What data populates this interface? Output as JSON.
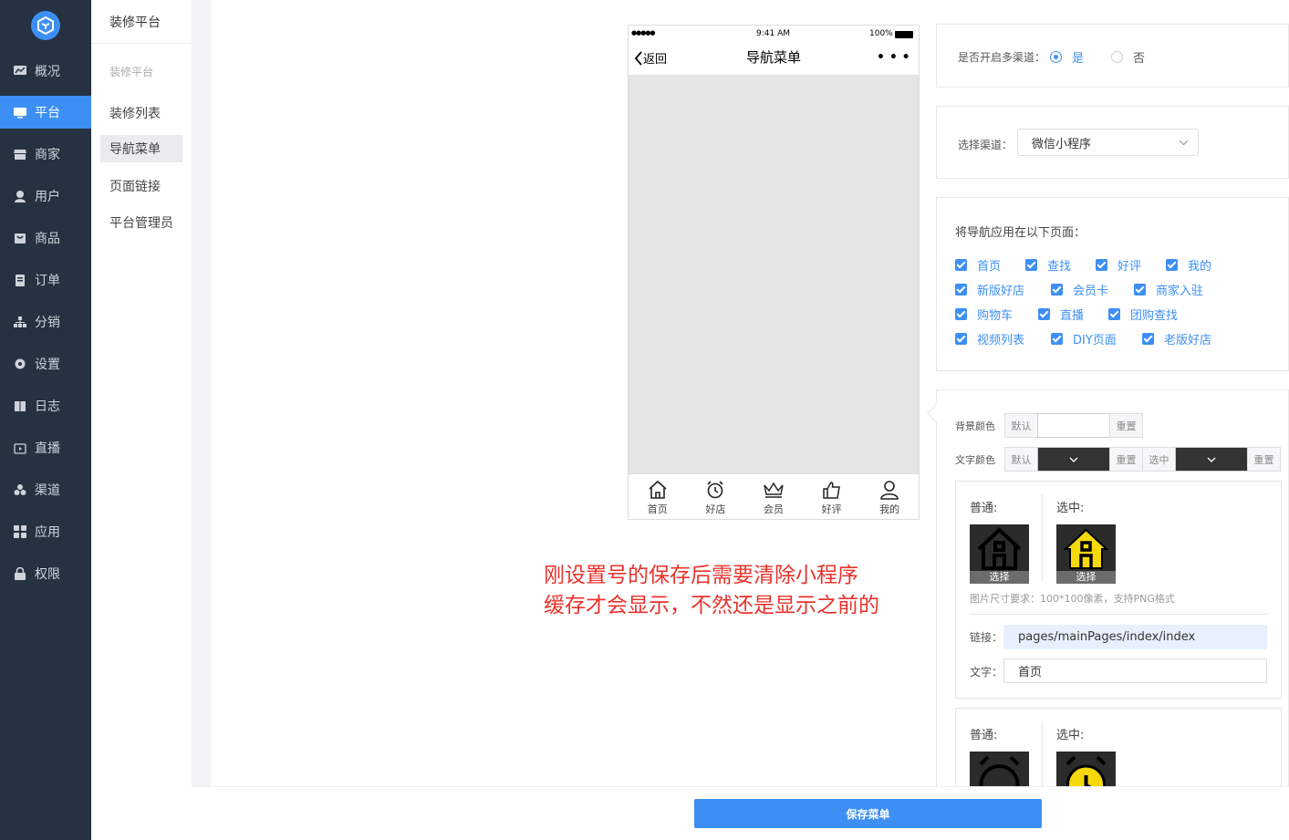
{
  "sidebar": {
    "items": [
      {
        "label": "概况",
        "icon": "chart-icon"
      },
      {
        "label": "平台",
        "icon": "monitor-icon"
      },
      {
        "label": "商家",
        "icon": "store-icon"
      },
      {
        "label": "用户",
        "icon": "user-icon"
      },
      {
        "label": "商品",
        "icon": "bag-icon"
      },
      {
        "label": "订单",
        "icon": "order-icon"
      },
      {
        "label": "分销",
        "icon": "tree-icon"
      },
      {
        "label": "设置",
        "icon": "gear-icon"
      },
      {
        "label": "日志",
        "icon": "book-icon"
      },
      {
        "label": "直播",
        "icon": "live-icon"
      },
      {
        "label": "渠道",
        "icon": "channel-icon"
      },
      {
        "label": "应用",
        "icon": "grid-icon"
      },
      {
        "label": "权限",
        "icon": "lock-icon"
      }
    ],
    "active": "平台"
  },
  "subnav": {
    "title": "装修平台",
    "group": "装修平台",
    "items": [
      "装修列表",
      "导航菜单",
      "页面链接",
      "平台管理员"
    ],
    "active": "导航菜单"
  },
  "phone": {
    "signal": "●●●●●",
    "time": "9:41 AM",
    "battery": "100%",
    "back_label": "返回",
    "title": "导航菜单",
    "more": "• • •",
    "tabs": [
      "首页",
      "好店",
      "会员",
      "好评",
      "我的"
    ]
  },
  "note": {
    "line1": "刚设置号的保存后需要清除小程序",
    "line2": "缓存才会显示，不然还是显示之前的"
  },
  "multi_channel": {
    "label": "是否开启多渠道：",
    "yes": "是",
    "no": "否",
    "selected": "是"
  },
  "channel_select": {
    "label": "选择渠道：",
    "value": "微信小程序"
  },
  "pages": {
    "title": "将导航应用在以下页面：",
    "options": [
      "首页",
      "查找",
      "好评",
      "我的",
      "新版好店",
      "会员卡",
      "商家入驻",
      "购物车",
      "直播",
      "团购查找",
      "视频列表",
      "DIY页面",
      "老版好店"
    ]
  },
  "style": {
    "bg_label": "背景颜色",
    "text_label": "文字颜色",
    "default": "默认",
    "reset": "重置",
    "selected": "选中",
    "bg_color": "#ffffff",
    "text_color": "#333333",
    "text_selected_color": "#333333"
  },
  "nav_items": [
    {
      "normal_label": "普通:",
      "selected_label": "选中:",
      "choose": "选择",
      "hint": "图片尺寸要求：100*100像素，支持PNG格式",
      "link_label": "链接：",
      "link": "pages/mainPages/index/index",
      "text_label": "文字：",
      "text": "首页",
      "icon": "home-icon"
    },
    {
      "normal_label": "普通:",
      "selected_label": "选中:",
      "icon": "alarm-clock-icon"
    }
  ],
  "footer": {
    "save_label": "保存菜单"
  },
  "colors": {
    "accent": "#3d8ff4",
    "sidebar": "#263141",
    "note": "#e8332c",
    "icon_selected": "#f5d90a"
  }
}
